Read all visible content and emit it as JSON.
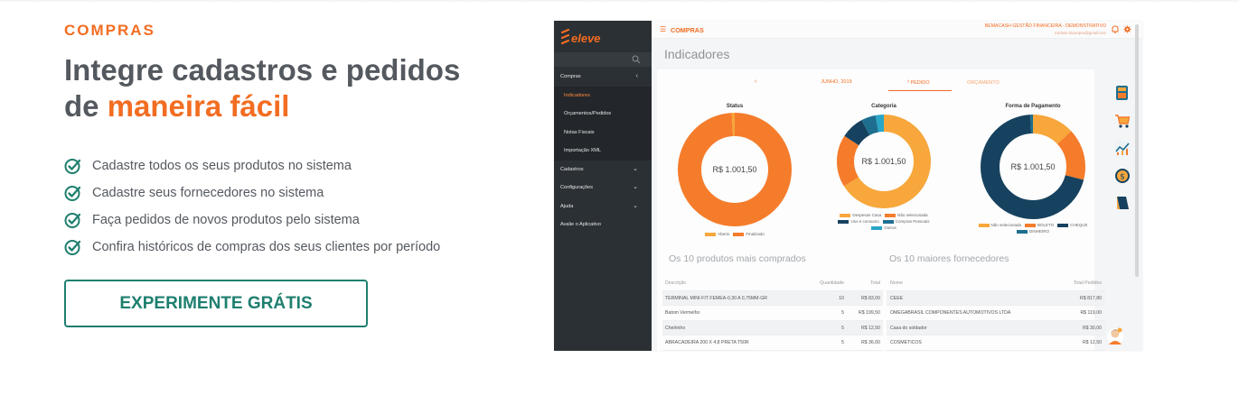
{
  "section": {
    "eyebrow": "COMPRAS",
    "headline_line1": "Integre cadastros e pedidos",
    "headline_prefix": "de ",
    "headline_highlight": "maneira fácil",
    "features": [
      "Cadastre todos os seus produtos no sistema",
      "Cadastre seus fornecedores no sistema",
      "Faça pedidos de novos produtos pelo sistema",
      "Confira históricos de compras dos seus clientes por período"
    ],
    "cta_label": "EXPERIMENTE GRÁTIS"
  },
  "app": {
    "logo_text": "eleve",
    "sidebar": {
      "items": [
        {
          "label": "Compras",
          "chevron": "‹",
          "sub": false,
          "active": false
        },
        {
          "label": "Indicadores",
          "chevron": "",
          "sub": true,
          "active": true
        },
        {
          "label": "Orçamentos/Pedidos",
          "chevron": "",
          "sub": true,
          "active": false
        },
        {
          "label": "Notas Fiscais",
          "chevron": "",
          "sub": true,
          "active": false
        },
        {
          "label": "Importação XML",
          "chevron": "",
          "sub": true,
          "active": false
        },
        {
          "label": "Cadastros",
          "chevron": "⌄",
          "sub": false,
          "active": false
        },
        {
          "label": "Configurações",
          "chevron": "⌄",
          "sub": false,
          "active": false
        },
        {
          "label": "Ajuda",
          "chevron": "⌄",
          "sub": false,
          "active": false
        },
        {
          "label": "Avalie o Aplicativo",
          "chevron": "",
          "sub": false,
          "active": false
        }
      ]
    },
    "topbar": {
      "module": "COMPRAS",
      "company": "BEMACASH GESTÃO FINANCEIRA - DEMONSTRATIVO",
      "email": "michele.bicampos@gmail.com"
    },
    "page_title": "Indicadores",
    "period": {
      "prev": "‹",
      "label": "JUNHO, 2019",
      "next": "›"
    },
    "tabs": [
      "PEDIDO",
      "ORÇAMENTO"
    ],
    "charts": [
      {
        "title": "Status",
        "center_label": "R$ 1.001,50",
        "legend": [
          {
            "name": "Aberto",
            "color": "#f7a73b"
          },
          {
            "name": "Finalizado",
            "color": "#f57c2b"
          }
        ],
        "slices": [
          {
            "value": 99,
            "color": "#f57c2b"
          },
          {
            "value": 1,
            "color": "#f7a73b"
          }
        ]
      },
      {
        "title": "Categoria",
        "center_label": "R$ 1.001,50",
        "legend": [
          {
            "name": "Despesas Casa",
            "color": "#f7a73b"
          },
          {
            "name": "Não selecionada",
            "color": "#f57c2b"
          },
          {
            "name": "Uso e consumo",
            "color": "#17425f"
          },
          {
            "name": "Compras Pessoais",
            "color": "#1e6f8f"
          },
          {
            "name": "Outros",
            "color": "#2aa6c7"
          }
        ],
        "slices": [
          {
            "value": 66,
            "color": "#f7a73b"
          },
          {
            "value": 18,
            "color": "#f57c2b"
          },
          {
            "value": 8,
            "color": "#17425f"
          },
          {
            "value": 5,
            "color": "#1e6f8f"
          },
          {
            "value": 3,
            "color": "#2aa6c7"
          }
        ]
      },
      {
        "title": "Forma de Pagamento",
        "center_label": "R$ 1.001,50",
        "legend": [
          {
            "name": "Não selecionada",
            "color": "#f7a73b"
          },
          {
            "name": "BOLETO",
            "color": "#f57c2b"
          },
          {
            "name": "CHEQUE",
            "color": "#17425f"
          },
          {
            "name": "DINHEIRO",
            "color": "#1e6f8f"
          }
        ],
        "slices": [
          {
            "value": 13,
            "color": "#f7a73b"
          },
          {
            "value": 16,
            "color": "#f57c2b"
          },
          {
            "value": 70,
            "color": "#17425f"
          },
          {
            "value": 1,
            "color": "#1e6f8f"
          }
        ]
      }
    ],
    "table_products": {
      "title": "Os 10 produtos mais comprados",
      "headers": [
        "Descrição",
        "Quantidade",
        "Total"
      ],
      "rows": [
        [
          "TERMINAL MINI-FIT FEMEA-0,30 A 0,75MM-GR",
          "10",
          "R$ 83,00"
        ],
        [
          "Batom Vermelho",
          "5",
          "R$ 199,50"
        ],
        [
          "Chelrinho",
          "5",
          "R$ 12,50"
        ],
        [
          "ABRACADEIRA 200 X 4,8 PRETA T50R",
          "5",
          "R$ 36,00"
        ]
      ]
    },
    "table_suppliers": {
      "title": "Os 10 maiores fornecedores",
      "headers": [
        "Nome",
        "Total Pedidos"
      ],
      "rows": [
        [
          "CEEE",
          "R$ 817,80"
        ],
        [
          "OMEGABRASIL COMPONENTES AUTOMOTIVOS LTDA",
          "R$ 119,00"
        ],
        [
          "Casa do soldador",
          "R$ 30,00"
        ],
        [
          "COSMETICOS",
          "R$ 12,50"
        ]
      ]
    }
  },
  "colors": {
    "accent": "#f26d22",
    "cta": "#1e7f6f",
    "sidebar": "#2b3034"
  }
}
